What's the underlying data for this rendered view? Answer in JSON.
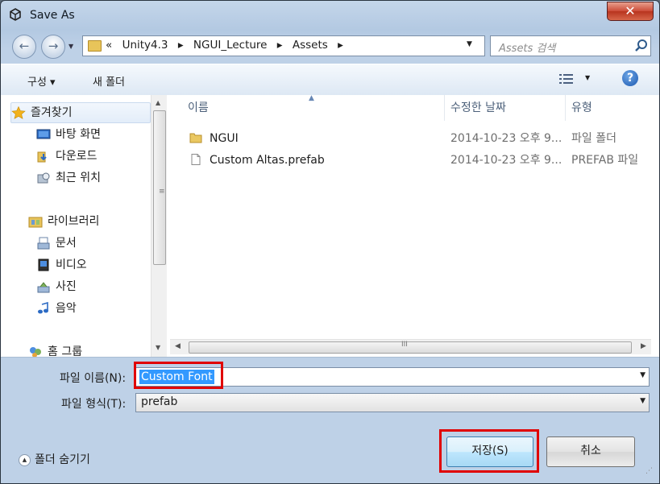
{
  "window": {
    "title": "Save As",
    "close_symbol": "✕"
  },
  "nav": {
    "back_symbol": "←",
    "forward_symbol": "→",
    "breadcrumb": [
      "«",
      "Unity4.3",
      "▸",
      "NGUI_Lecture",
      "▸",
      "Assets",
      "▸"
    ],
    "search_placeholder": "Assets 검색"
  },
  "toolbar": {
    "organize": "구성 ▾",
    "new_folder": "새 폴더",
    "view_drop": "▼",
    "help": "?"
  },
  "sidebar": {
    "items": [
      {
        "label": "즐겨찾기",
        "icon": "star-icon"
      },
      {
        "label": "바탕 화면",
        "icon": "desktop-icon"
      },
      {
        "label": "다운로드",
        "icon": "download-folder-icon"
      },
      {
        "label": "최근 위치",
        "icon": "recent-places-icon"
      },
      {
        "label": "라이브러리",
        "icon": "library-icon"
      },
      {
        "label": "문서",
        "icon": "documents-icon"
      },
      {
        "label": "비디오",
        "icon": "videos-icon"
      },
      {
        "label": "사진",
        "icon": "pictures-icon"
      },
      {
        "label": "음악",
        "icon": "music-icon"
      },
      {
        "label": "홈 그룹",
        "icon": "homegroup-icon"
      }
    ]
  },
  "files": {
    "columns": [
      "이름",
      "수정한 날짜",
      "유형"
    ],
    "rows": [
      {
        "name": "NGUI",
        "date": "2014-10-23 오후 9...",
        "type": "파일 폴더",
        "icon": "folder-icon"
      },
      {
        "name": "Custom Altas.prefab",
        "date": "2014-10-23 오후 9...",
        "type": "PREFAB 파일",
        "icon": "file-icon"
      }
    ],
    "scroll_grip": "III"
  },
  "form": {
    "file_name_label": "파일 이름(N):",
    "file_name_value": "Custom Font",
    "file_type_label": "파일 형식(T):",
    "file_type_value": "prefab"
  },
  "buttons": {
    "save": "저장(S)",
    "cancel": "취소",
    "hide_folders": "폴더 숨기기"
  },
  "colors": {
    "highlight": "#e00000",
    "selection": "#3399ff"
  }
}
